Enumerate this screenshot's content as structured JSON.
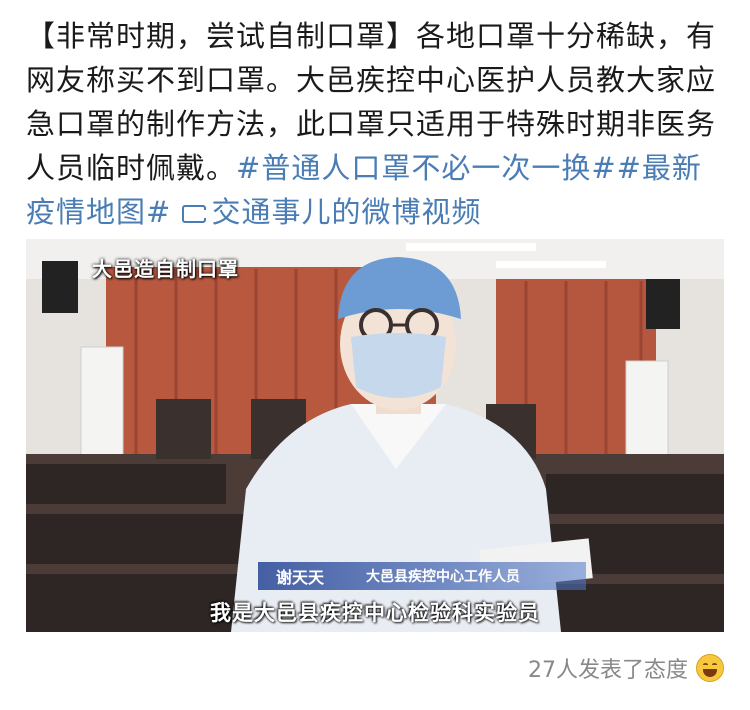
{
  "post": {
    "segments": [
      {
        "type": "text",
        "value": "【非常时期，尝试自制口罩】各地口罩十分稀缺，有网友称买不到口罩。大邑疾控中心医护人员教大家应急口罩的制作方法，此口罩只适用于特殊时期非医务人员临时佩戴。"
      },
      {
        "type": "tag",
        "value": "#普通人口罩不必一次一换#"
      },
      {
        "type": "tag",
        "value": "#最新疫情地图#"
      },
      {
        "type": "link",
        "value": "交通事儿的微博视频",
        "icon": "video-icon"
      }
    ]
  },
  "video": {
    "channel_logo": "大邑造自制口罩",
    "name_bar": {
      "person": "谢天天",
      "role": "大邑县疾控中心工作人员"
    },
    "subtitle": "我是大邑县疾控中心检验科实验员"
  },
  "footer": {
    "reactions": "27人发表了态度",
    "emoji": "grinning-emoji-icon"
  },
  "colors": {
    "link": "#4a7db5",
    "meta": "#888888"
  }
}
